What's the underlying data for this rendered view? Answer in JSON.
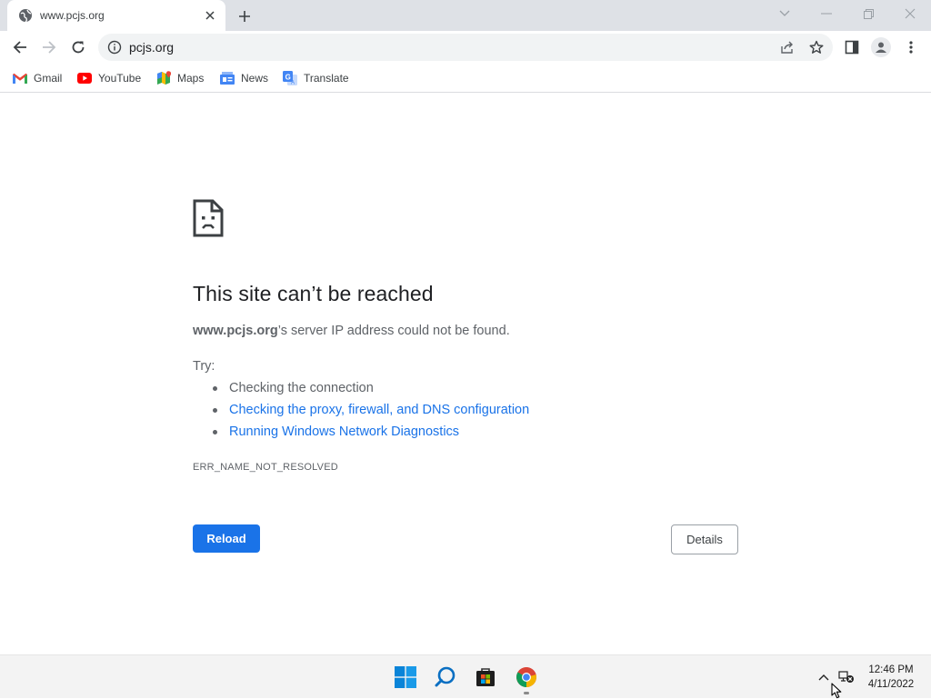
{
  "browser": {
    "tab": {
      "title": "www.pcjs.org",
      "favicon": "globe-icon"
    },
    "new_tab_icon": "plus-icon",
    "window_controls": [
      "chevron-down-icon",
      "minimize-icon",
      "restore-icon",
      "close-icon"
    ],
    "address": {
      "url": "pcjs.org",
      "security_icon": "info-icon"
    },
    "toolbar_icons": [
      "share-icon",
      "bookmark-star-icon",
      "side-panel-icon",
      "profile-icon",
      "menu-icon"
    ],
    "bookmarks": [
      {
        "label": "Gmail",
        "icon": "gmail-icon"
      },
      {
        "label": "YouTube",
        "icon": "youtube-icon"
      },
      {
        "label": "Maps",
        "icon": "maps-icon"
      },
      {
        "label": "News",
        "icon": "news-icon"
      },
      {
        "label": "Translate",
        "icon": "translate-icon"
      }
    ]
  },
  "error_page": {
    "icon": "sad-file-icon",
    "title": "This site can’t be reached",
    "host": "www.pcjs.org",
    "description": "’s server IP address could not be found.",
    "try_label": "Try:",
    "suggestions": [
      {
        "text": "Checking the connection",
        "is_link": false
      },
      {
        "text": "Checking the proxy, firewall, and DNS configuration",
        "is_link": true
      },
      {
        "text": "Running Windows Network Diagnostics",
        "is_link": true
      }
    ],
    "error_code": "ERR_NAME_NOT_RESOLVED",
    "reload_label": "Reload",
    "details_label": "Details"
  },
  "taskbar": {
    "apps": [
      "windows-start-icon",
      "search-icon",
      "store-icon",
      "chrome-icon"
    ],
    "tray": [
      "chevron-up-icon",
      "network-disconnected-icon"
    ],
    "time": "12:46 PM",
    "date": "4/11/2022"
  },
  "colors": {
    "accent": "#1a73e8",
    "tabstrip": "#dee1e6",
    "text_secondary": "#5f6368",
    "taskbar": "#f3f3f3"
  }
}
